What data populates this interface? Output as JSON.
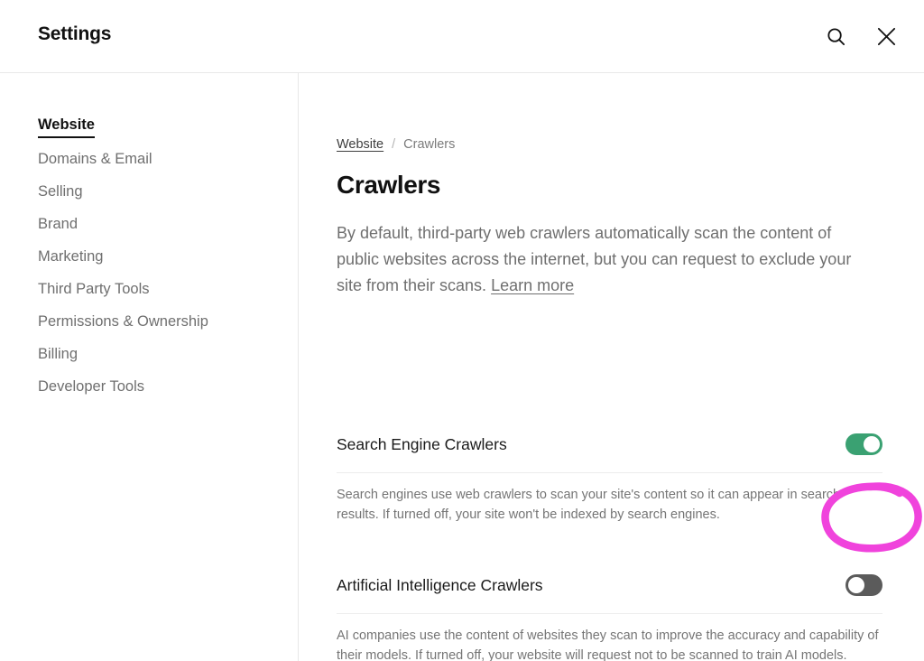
{
  "header": {
    "title": "Settings",
    "search_icon": "search-icon",
    "close_icon": "close-icon"
  },
  "sidebar": {
    "items": [
      {
        "label": "Website",
        "active": true
      },
      {
        "label": "Domains & Email",
        "active": false
      },
      {
        "label": "Selling",
        "active": false
      },
      {
        "label": "Brand",
        "active": false
      },
      {
        "label": "Marketing",
        "active": false
      },
      {
        "label": "Third Party Tools",
        "active": false
      },
      {
        "label": "Permissions & Ownership",
        "active": false
      },
      {
        "label": "Billing",
        "active": false
      },
      {
        "label": "Developer Tools",
        "active": false
      }
    ]
  },
  "main": {
    "breadcrumb": {
      "parent": "Website",
      "separator": "/",
      "current": "Crawlers"
    },
    "page_title": "Crawlers",
    "description": "By default, third-party web crawlers automatically scan the content of public websites across the internet, but you can request to exclude your site from their scans.",
    "description_link": "Learn more",
    "settings": [
      {
        "label": "Search Engine Crawlers",
        "toggle_state": "on",
        "description": "Search engines use web crawlers to scan your site's content so it can appear in search results. If turned off, your site won't be indexed by search engines."
      },
      {
        "label": "Artificial Intelligence Crawlers",
        "toggle_state": "off",
        "description": "AI companies use the content of websites they scan to improve the accuracy and capability of their models. If turned off, your website will request not to be scanned to train AI models."
      }
    ]
  },
  "annotation": {
    "shape": "hand-drawn-ellipse",
    "target": "artificial-intelligence-crawlers-toggle",
    "color": "#f043dc"
  },
  "colors": {
    "toggle_on": "#3aa172",
    "toggle_off": "#5b5b5b",
    "text_primary": "#111111",
    "text_secondary": "#6f6f6f",
    "divider": "#e8e8e8",
    "annotation": "#f043dc"
  }
}
